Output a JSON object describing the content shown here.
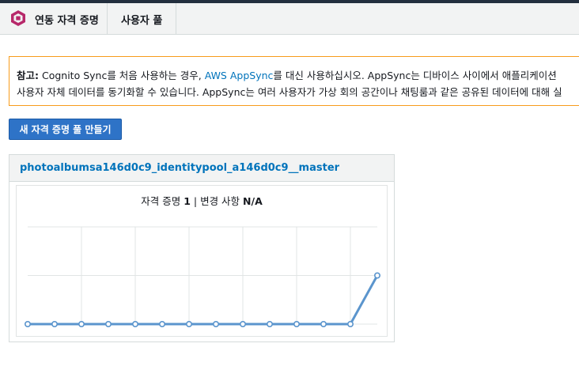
{
  "subnav": {
    "home_label": "연동 자격 증명",
    "pool_label": "사용자 풀"
  },
  "notice": {
    "bold_prefix": "참고:",
    "text_a": " Cognito Sync를 처음 사용하는 경우, ",
    "link": "AWS AppSync",
    "text_b": "를 대신 사용하십시오. AppSync는 디바이스 사이에서 애플리케이션",
    "line2": "사용자 자체 데이터를 동기화할 수 있습니다. AppSync는 여러 사용자가 가상 회의 공간이나 채팅룸과 같은 공유된 데이터에 대해 실"
  },
  "create_button": "새 자격 증명 풀 만들기",
  "pool": {
    "name": "photoalbumsa146d0c9_identitypool_a146d0c9__master",
    "identities_label": "자격 증명",
    "identities_value": "1",
    "separator": " | ",
    "changes_label": "변경 사항",
    "changes_value": "N/A"
  },
  "chart_data": {
    "type": "line",
    "x": [
      1,
      2,
      3,
      4,
      5,
      6,
      7,
      8,
      9,
      10,
      11,
      12,
      13,
      14
    ],
    "series": [
      {
        "values": [
          0,
          0,
          0,
          0,
          0,
          0,
          0,
          0,
          0,
          0,
          0,
          0,
          0,
          1
        ]
      }
    ],
    "ylim": [
      0,
      2
    ],
    "grid": true,
    "line_color": "#5b95cd"
  }
}
